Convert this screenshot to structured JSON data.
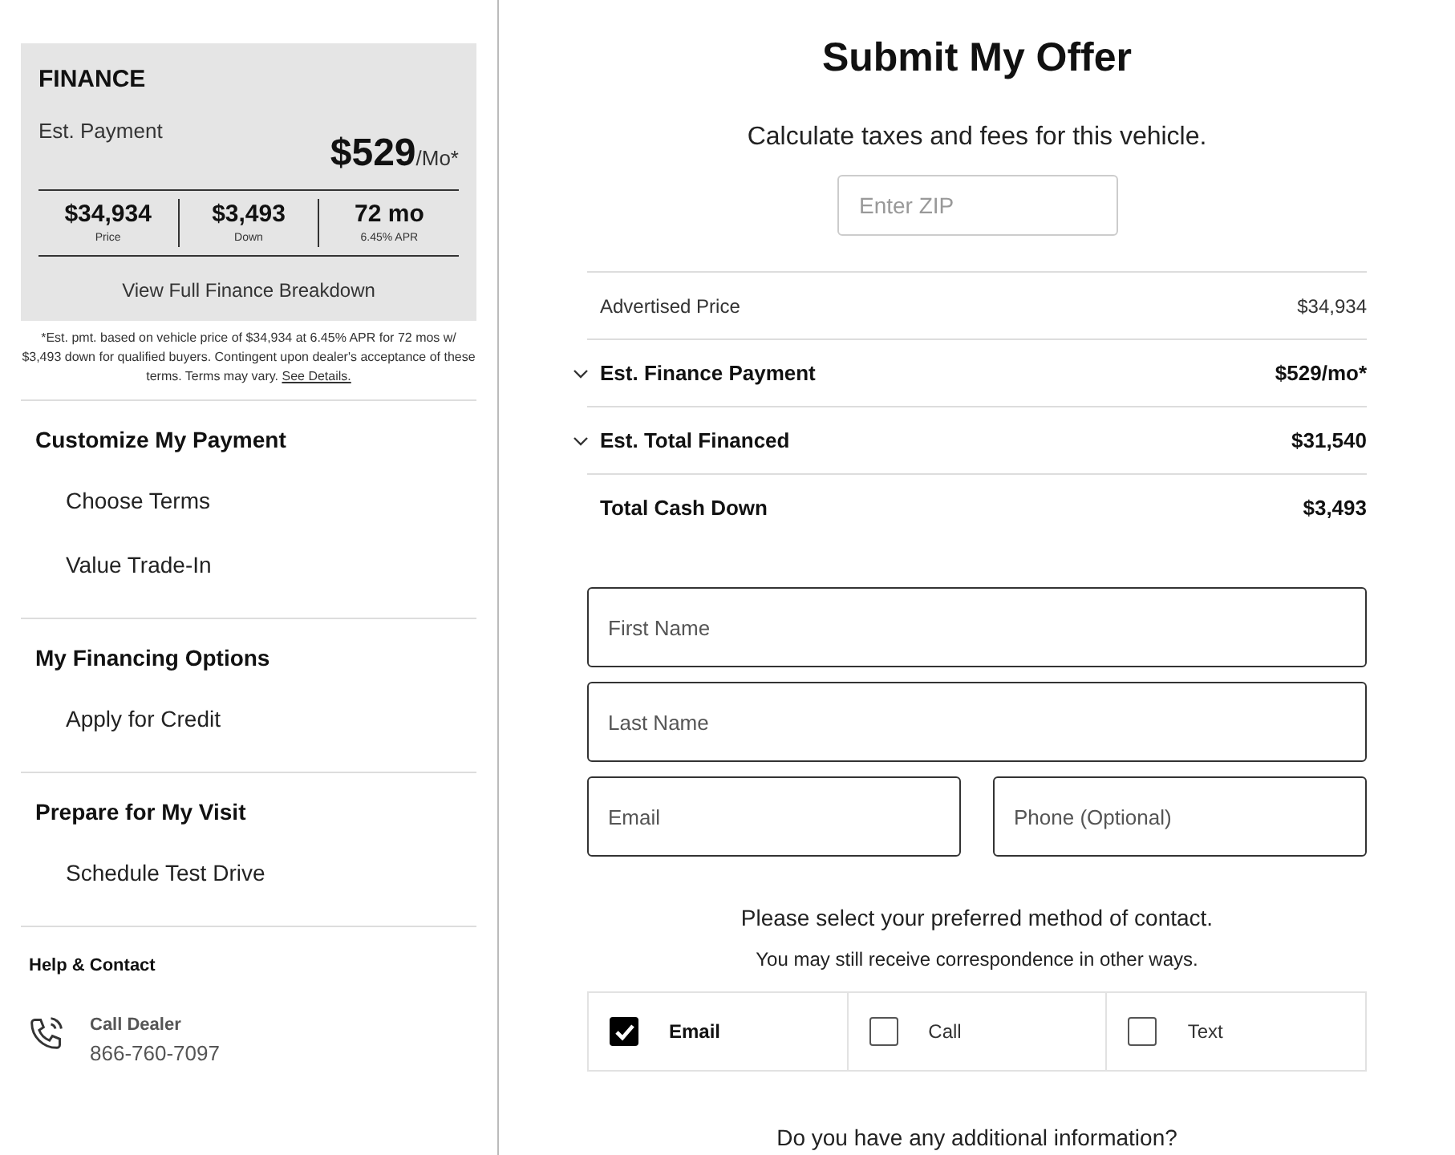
{
  "finance": {
    "title": "FINANCE",
    "payment_label": "Est. Payment",
    "payment": "$529",
    "payment_unit": "/Mo*",
    "stats": [
      {
        "value": "$34,934",
        "label": "Price"
      },
      {
        "value": "$3,493",
        "label": "Down"
      },
      {
        "value": "72 mo",
        "label": "6.45% APR"
      }
    ],
    "breakdown_link": "View Full Finance Breakdown"
  },
  "disclaimer": {
    "text": "*Est. pmt. based on vehicle price of $34,934 at 6.45% APR for 72 mos w/ $3,493 down for qualified buyers. Contingent upon dealer's acceptance of these terms. Terms may vary.",
    "link": "See Details."
  },
  "sections": [
    {
      "title": "Customize My Payment",
      "items": [
        "Choose Terms",
        "Value Trade-In"
      ]
    },
    {
      "title": "My Financing Options",
      "items": [
        "Apply for Credit"
      ]
    },
    {
      "title": "Prepare for My Visit",
      "items": [
        "Schedule Test Drive"
      ]
    }
  ],
  "help": {
    "title": "Help & Contact",
    "contact_label": "Call Dealer",
    "phone": "866-760-7097"
  },
  "main": {
    "title": "Submit My Offer",
    "subtitle": "Calculate taxes and fees for this vehicle.",
    "zip": {
      "placeholder": "Enter ZIP"
    },
    "rows": [
      {
        "kind": "plain",
        "label": "Advertised Price",
        "value": "$34,934"
      },
      {
        "kind": "expandable",
        "label": "Est. Finance Payment",
        "value": "$529/mo*"
      },
      {
        "kind": "expandable",
        "label": "Est. Total Financed",
        "value": "$31,540"
      },
      {
        "kind": "total",
        "label": "Total Cash Down",
        "value": "$3,493"
      }
    ],
    "fields": {
      "first_name": {
        "placeholder": "First Name"
      },
      "last_name": {
        "placeholder": "Last Name"
      },
      "email": {
        "placeholder": "Email"
      },
      "phone": {
        "placeholder": "Phone (Optional)"
      }
    },
    "contact_prompt": "Please select your preferred method of contact.",
    "contact_note": "You may still receive correspondence in other ways.",
    "contact_methods": [
      {
        "label": "Email",
        "checked": true
      },
      {
        "label": "Call",
        "checked": false
      },
      {
        "label": "Text",
        "checked": false
      }
    ],
    "additional_prompt": "Do you have any additional information?"
  }
}
